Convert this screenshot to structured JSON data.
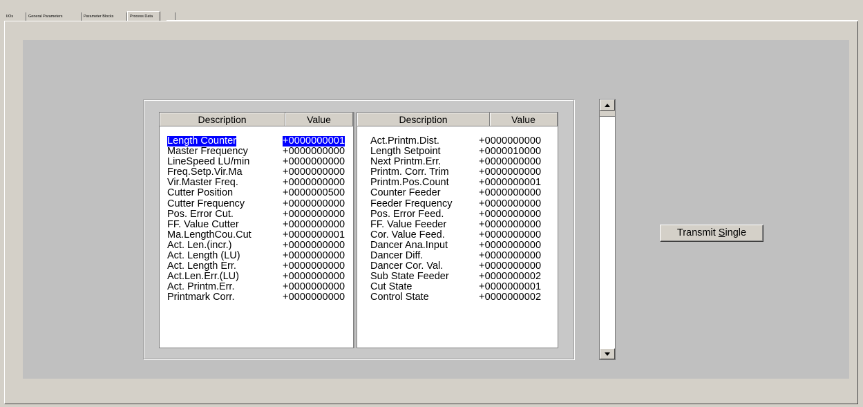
{
  "tabs": [
    {
      "label": "I/Os",
      "active": false
    },
    {
      "label": "General Parameters",
      "active": false
    },
    {
      "label": "Parameter Blocks",
      "active": false
    },
    {
      "label": "Process Data",
      "active": true
    },
    {
      "label": "",
      "active": false
    }
  ],
  "table_left": {
    "headers": [
      "Description",
      "Value"
    ],
    "rows": [
      {
        "description": "Length Counter",
        "value": "+0000000001",
        "selected": true
      },
      {
        "description": "Master Frequency",
        "value": "+0000000000"
      },
      {
        "description": "LineSpeed LU/min",
        "value": "+0000000000"
      },
      {
        "description": "Freq.Setp.Vir.Ma",
        "value": "+0000000000"
      },
      {
        "description": "Vir.Master Freq.",
        "value": "+0000000000"
      },
      {
        "description": "Cutter Position",
        "value": "+0000000500"
      },
      {
        "description": "Cutter Frequency",
        "value": "+0000000000"
      },
      {
        "description": "Pos. Error Cut.",
        "value": "+0000000000"
      },
      {
        "description": "FF. Value Cutter",
        "value": "+0000000000"
      },
      {
        "description": "Ma.LengthCou.Cut",
        "value": "+0000000001"
      },
      {
        "description": "Act. Len.(incr.)",
        "value": "+0000000000"
      },
      {
        "description": "Act. Length (LU)",
        "value": "+0000000000"
      },
      {
        "description": "Act. Length Err.",
        "value": "+0000000000"
      },
      {
        "description": "Act.Len.Err.(LU)",
        "value": "+0000000000"
      },
      {
        "description": "Act. Printm.Err.",
        "value": "+0000000000"
      },
      {
        "description": "Printmark Corr.",
        "value": "+0000000000"
      }
    ]
  },
  "table_right": {
    "headers": [
      "Description",
      "Value"
    ],
    "rows": [
      {
        "description": "Act.Printm.Dist.",
        "value": "+0000000000"
      },
      {
        "description": "Length Setpoint",
        "value": "+0000010000"
      },
      {
        "description": "Next  Printm.Err.",
        "value": "+0000000000"
      },
      {
        "description": "Printm. Corr. Trim",
        "value": "+0000000000"
      },
      {
        "description": "Printm.Pos.Count",
        "value": "+0000000001"
      },
      {
        "description": "Counter Feeder",
        "value": "+0000000000"
      },
      {
        "description": "Feeder Frequency",
        "value": "+0000000000"
      },
      {
        "description": "Pos. Error Feed.",
        "value": "+0000000000"
      },
      {
        "description": "FF. Value Feeder",
        "value": "+0000000000"
      },
      {
        "description": "Cor. Value Feed.",
        "value": "+0000000000"
      },
      {
        "description": "Dancer Ana.Input",
        "value": "+0000000000"
      },
      {
        "description": "Dancer Diff.",
        "value": "+0000000000"
      },
      {
        "description": "Dancer Cor. Val.",
        "value": "+0000000000"
      },
      {
        "description": "Sub State Feeder",
        "value": "+0000000002"
      },
      {
        "description": "Cut State",
        "value": "+0000000001"
      },
      {
        "description": "Control State",
        "value": "+0000000002"
      }
    ]
  },
  "scrollbar": {
    "up_icon": "arrow-up-icon",
    "down_icon": "arrow-down-icon"
  },
  "transmit_button": {
    "label_pre": "Transmit ",
    "label_mnemonic": "S",
    "label_post": "ingle"
  },
  "colors": {
    "selection": "#0000ff",
    "face": "#d4d0c8",
    "panel": "#c0c0c0"
  }
}
